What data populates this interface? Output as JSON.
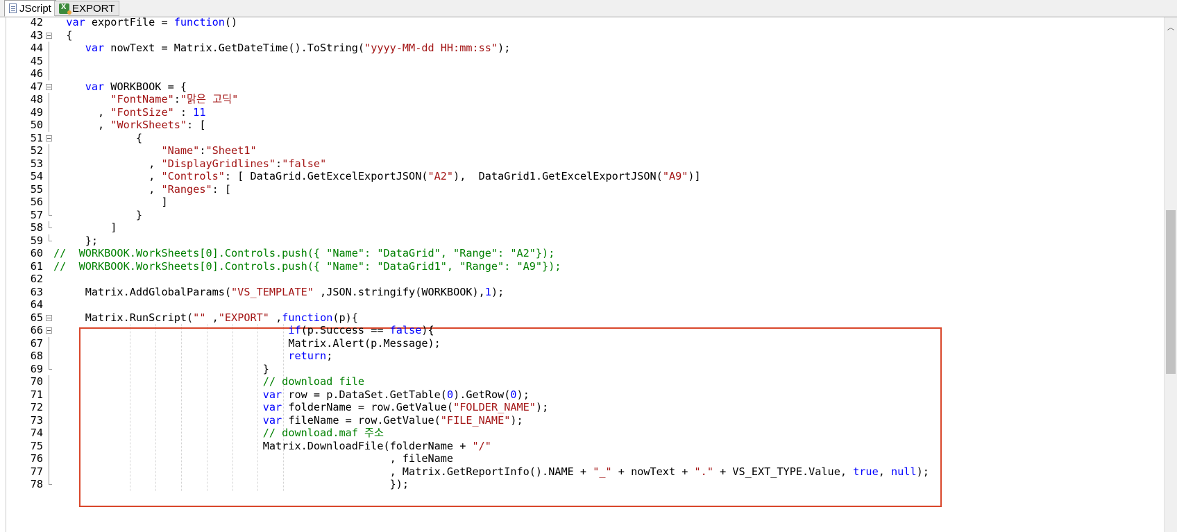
{
  "tabs": [
    {
      "label": "JScript",
      "icon": "document-icon",
      "active": true
    },
    {
      "label": "EXPORT",
      "icon": "excel-icon",
      "active": false
    }
  ],
  "lines": [
    {
      "n": "42",
      "fold": "",
      "tokens": [
        [
          "",
          "  "
        ],
        [
          "kw",
          "var"
        ],
        [
          "",
          " exportFile = "
        ],
        [
          "kw",
          "function"
        ],
        [
          "",
          "()"
        ]
      ]
    },
    {
      "n": "43",
      "fold": "box",
      "tokens": [
        [
          "",
          "  {"
        ]
      ]
    },
    {
      "n": "44",
      "fold": "vline",
      "tokens": [
        [
          "",
          "     "
        ],
        [
          "kw",
          "var"
        ],
        [
          "",
          " nowText = Matrix.GetDateTime().ToString("
        ],
        [
          "str",
          "\"yyyy-MM-dd HH:mm:ss\""
        ],
        [
          "",
          ");"
        ]
      ]
    },
    {
      "n": "45",
      "fold": "vline",
      "tokens": []
    },
    {
      "n": "46",
      "fold": "vline",
      "tokens": []
    },
    {
      "n": "47",
      "fold": "box",
      "tokens": [
        [
          "",
          "     "
        ],
        [
          "kw",
          "var"
        ],
        [
          "",
          " WORKBOOK = {"
        ]
      ]
    },
    {
      "n": "48",
      "fold": "vline",
      "tokens": [
        [
          "",
          "         "
        ],
        [
          "str",
          "\"FontName\""
        ],
        [
          "",
          ":"
        ],
        [
          "str",
          "\"맑은 고딕\""
        ]
      ]
    },
    {
      "n": "49",
      "fold": "vline",
      "tokens": [
        [
          "",
          "       , "
        ],
        [
          "str",
          "\"FontSize\""
        ],
        [
          "",
          " : "
        ],
        [
          "num",
          "11"
        ]
      ]
    },
    {
      "n": "50",
      "fold": "vline",
      "tokens": [
        [
          "",
          "       , "
        ],
        [
          "str",
          "\"WorkSheets\""
        ],
        [
          "",
          ": ["
        ]
      ]
    },
    {
      "n": "51",
      "fold": "box",
      "tokens": [
        [
          "",
          "             {"
        ]
      ]
    },
    {
      "n": "52",
      "fold": "vline",
      "tokens": [
        [
          "",
          "                 "
        ],
        [
          "str",
          "\"Name\""
        ],
        [
          "",
          ":"
        ],
        [
          "str",
          "\"Sheet1\""
        ]
      ]
    },
    {
      "n": "53",
      "fold": "vline",
      "tokens": [
        [
          "",
          "               , "
        ],
        [
          "str",
          "\"DisplayGridlines\""
        ],
        [
          "",
          ":"
        ],
        [
          "str",
          "\"false\""
        ]
      ]
    },
    {
      "n": "54",
      "fold": "vline",
      "tokens": [
        [
          "",
          "               , "
        ],
        [
          "str",
          "\"Controls\""
        ],
        [
          "",
          ": [ DataGrid.GetExcelExportJSON("
        ],
        [
          "str",
          "\"A2\""
        ],
        [
          "",
          "),  DataGrid1.GetExcelExportJSON("
        ],
        [
          "str",
          "\"A9\""
        ],
        [
          "",
          ")]"
        ]
      ]
    },
    {
      "n": "55",
      "fold": "vline",
      "tokens": [
        [
          "",
          "               , "
        ],
        [
          "str",
          "\"Ranges\""
        ],
        [
          "",
          ": ["
        ]
      ]
    },
    {
      "n": "56",
      "fold": "vline",
      "tokens": [
        [
          "",
          "                 ]"
        ]
      ]
    },
    {
      "n": "57",
      "fold": "end",
      "tokens": [
        [
          "",
          "             }"
        ]
      ]
    },
    {
      "n": "58",
      "fold": "end",
      "tokens": [
        [
          "",
          "         ]"
        ]
      ]
    },
    {
      "n": "59",
      "fold": "end",
      "tokens": [
        [
          "",
          "     };"
        ]
      ]
    },
    {
      "n": "60",
      "fold": "",
      "tokens": [
        [
          "com",
          "//  WORKBOOK.WorkSheets[0].Controls.push({ \"Name\": \"DataGrid\", \"Range\": \"A2\"});"
        ]
      ]
    },
    {
      "n": "61",
      "fold": "",
      "tokens": [
        [
          "com",
          "//  WORKBOOK.WorkSheets[0].Controls.push({ \"Name\": \"DataGrid1\", \"Range\": \"A9\"});"
        ]
      ]
    },
    {
      "n": "62",
      "fold": "",
      "tokens": []
    },
    {
      "n": "63",
      "fold": "",
      "tokens": [
        [
          "",
          "     Matrix.AddGlobalParams("
        ],
        [
          "str",
          "\"VS_TEMPLATE\""
        ],
        [
          "",
          " ,JSON.stringify(WORKBOOK),"
        ],
        [
          "num",
          "1"
        ],
        [
          "",
          ");"
        ]
      ]
    },
    {
      "n": "64",
      "fold": "",
      "tokens": []
    },
    {
      "n": "65",
      "fold": "box",
      "tokens": [
        [
          "",
          "     Matrix.RunScript("
        ],
        [
          "str",
          "\"\""
        ],
        [
          "",
          " ,"
        ],
        [
          "str",
          "\"EXPORT\""
        ],
        [
          "",
          " ,"
        ],
        [
          "kw",
          "function"
        ],
        [
          "",
          "(p){"
        ]
      ]
    },
    {
      "n": "66",
      "fold": "box",
      "tokens": [
        [
          "",
          "                                     "
        ],
        [
          "kw",
          "if"
        ],
        [
          "",
          "(p.Success == "
        ],
        [
          "kw",
          "false"
        ],
        [
          "",
          "){"
        ]
      ]
    },
    {
      "n": "67",
      "fold": "vline",
      "tokens": [
        [
          "",
          "                                     Matrix.Alert(p.Message);"
        ]
      ]
    },
    {
      "n": "68",
      "fold": "vline",
      "tokens": [
        [
          "",
          "                                     "
        ],
        [
          "kw",
          "return"
        ],
        [
          "",
          ";"
        ]
      ]
    },
    {
      "n": "69",
      "fold": "end",
      "tokens": [
        [
          "",
          "                                 }"
        ]
      ]
    },
    {
      "n": "70",
      "fold": "vline",
      "tokens": [
        [
          "",
          "                                 "
        ],
        [
          "com",
          "// download file"
        ]
      ]
    },
    {
      "n": "71",
      "fold": "vline",
      "tokens": [
        [
          "",
          "                                 "
        ],
        [
          "kw",
          "var"
        ],
        [
          "",
          " row = p.DataSet.GetTable("
        ],
        [
          "num",
          "0"
        ],
        [
          "",
          ").GetRow("
        ],
        [
          "num",
          "0"
        ],
        [
          "",
          ");"
        ]
      ]
    },
    {
      "n": "72",
      "fold": "vline",
      "tokens": [
        [
          "",
          "                                 "
        ],
        [
          "kw",
          "var"
        ],
        [
          "",
          " folderName = row.GetValue("
        ],
        [
          "str",
          "\"FOLDER_NAME\""
        ],
        [
          "",
          ");"
        ]
      ]
    },
    {
      "n": "73",
      "fold": "vline",
      "tokens": [
        [
          "",
          "                                 "
        ],
        [
          "kw",
          "var"
        ],
        [
          "",
          " fileName = row.GetValue("
        ],
        [
          "str",
          "\"FILE_NAME\""
        ],
        [
          "",
          ");"
        ]
      ]
    },
    {
      "n": "74",
      "fold": "vline",
      "tokens": [
        [
          "",
          "                                 "
        ],
        [
          "com",
          "// download.maf 주소"
        ]
      ]
    },
    {
      "n": "75",
      "fold": "vline",
      "tokens": [
        [
          "",
          "                                 Matrix.DownloadFile(folderName + "
        ],
        [
          "str",
          "\"/\""
        ]
      ]
    },
    {
      "n": "76",
      "fold": "vline",
      "tokens": [
        [
          "",
          "                                                     , fileName"
        ]
      ]
    },
    {
      "n": "77",
      "fold": "vline",
      "tokens": [
        [
          "",
          "                                                     , Matrix.GetReportInfo().NAME + "
        ],
        [
          "str",
          "\"_\""
        ],
        [
          "",
          " + nowText + "
        ],
        [
          "str",
          "\".\""
        ],
        [
          "",
          " + VS_EXT_TYPE.Value, "
        ],
        [
          "kw",
          "true"
        ],
        [
          "",
          ", "
        ],
        [
          "kw",
          "null"
        ],
        [
          "",
          ");"
        ]
      ]
    },
    {
      "n": "78",
      "fold": "end",
      "tokens": [
        [
          "",
          "                                                     });"
        ]
      ]
    }
  ]
}
